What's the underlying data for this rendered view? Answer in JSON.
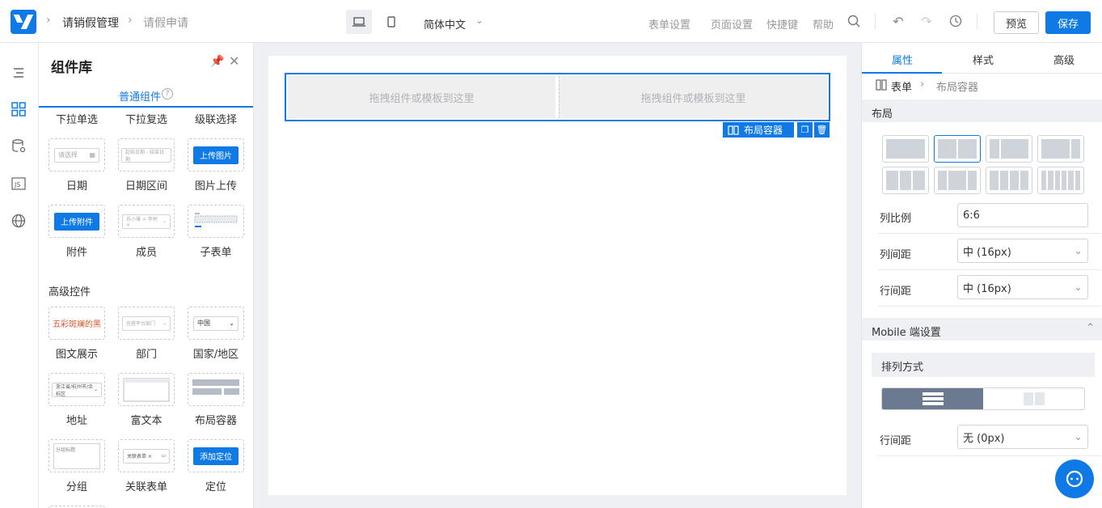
{
  "header": {
    "crumbs": [
      "请销假管理",
      "请假申请"
    ],
    "language": "简体中文",
    "links": [
      "表单设置",
      "页面设置",
      "快捷键",
      "帮助"
    ],
    "preview_label": "预览",
    "save_label": "保存"
  },
  "component_panel": {
    "title": "组件库",
    "tab": "普通组件",
    "top_labels": [
      "下拉单选",
      "下拉复选",
      "级联选择"
    ],
    "basic": [
      {
        "label": "日期",
        "preview": "请选择"
      },
      {
        "label": "日期区间",
        "preview": "起始日期 - 结束日期"
      },
      {
        "label": "图片上传",
        "preview": "上传图片"
      },
      {
        "label": "附件",
        "preview": "上传附件"
      },
      {
        "label": "成员",
        "preview": "苏小雅 × 李柯 ×"
      },
      {
        "label": "子表单",
        "preview": ""
      }
    ],
    "advanced_title": "高级控件",
    "advanced": [
      {
        "label": "图文展示",
        "preview": "五彩斑斓的黑"
      },
      {
        "label": "部门",
        "preview": "宜搭平台部门"
      },
      {
        "label": "国家/地区",
        "preview": "中国"
      },
      {
        "label": "地址",
        "preview": "浙江省/杭州市/余杭区"
      },
      {
        "label": "富文本",
        "preview": ""
      },
      {
        "label": "布局容器",
        "preview": ""
      },
      {
        "label": "分组",
        "preview": "分组标题"
      },
      {
        "label": "关联表单",
        "preview": "关联表单 ×"
      },
      {
        "label": "定位",
        "preview": "添加定位"
      }
    ]
  },
  "canvas": {
    "drop_hint_left": "拖拽组件或模板到这里",
    "drop_hint_right": "拖拽组件或模板到这里",
    "container_tag": "布局容器"
  },
  "props_panel": {
    "tabs": [
      "属性",
      "样式",
      "高级"
    ],
    "crumb_root": "表单",
    "crumb_current": "布局容器",
    "section_layout": "布局",
    "col_ratio_label": "列比例",
    "col_ratio_value": "6:6",
    "col_gap_label": "列间距",
    "col_gap_value": "中 (16px)",
    "row_gap_label": "行间距",
    "row_gap_value": "中 (16px)",
    "section_mobile": "Mobile 端设置",
    "arrange_label": "排列方式",
    "mobile_row_gap_label": "行间距",
    "mobile_row_gap_value": "无 (0px)"
  },
  "colors": {
    "accent": "#0f7ae6",
    "toggle_on": "#6c7a8f"
  }
}
